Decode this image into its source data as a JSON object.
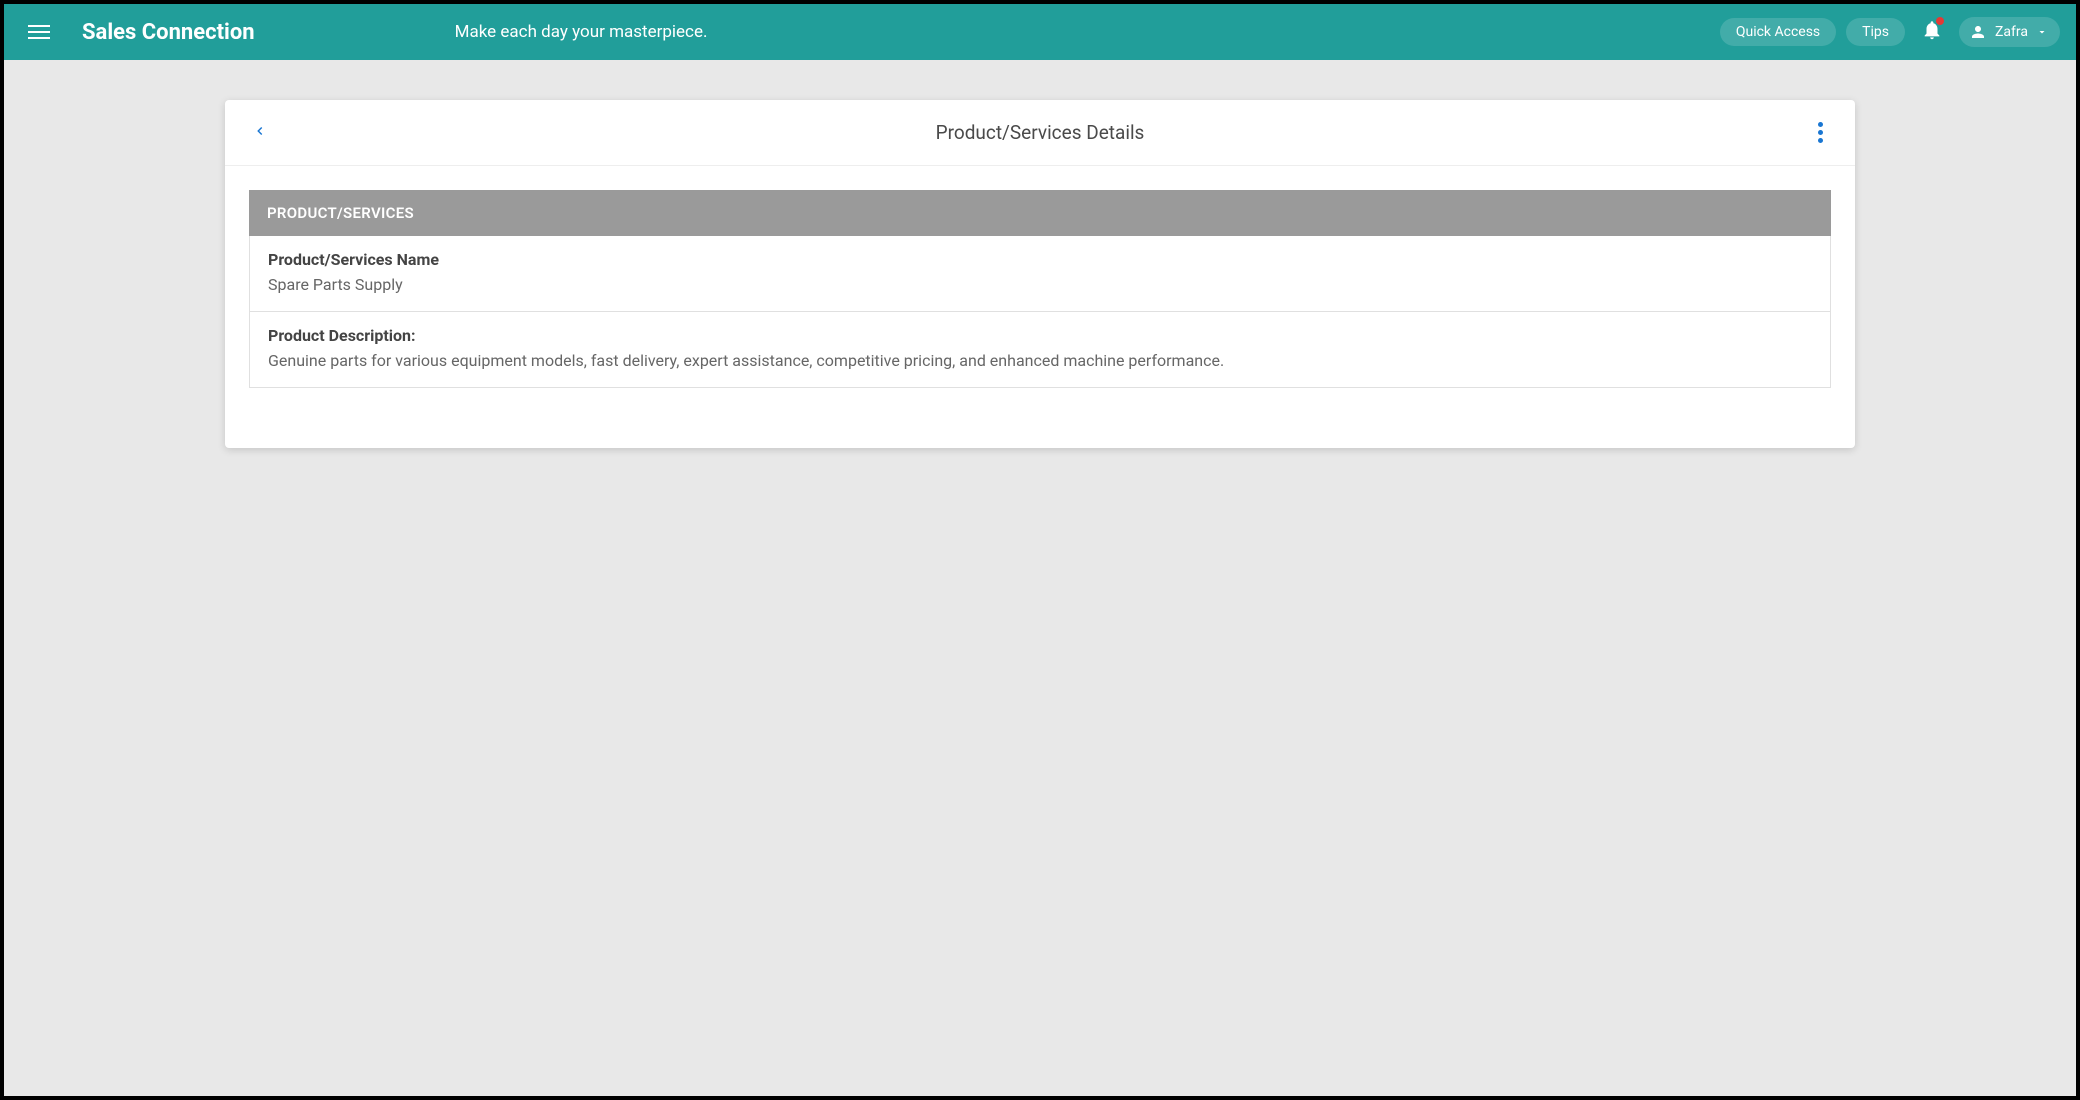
{
  "header": {
    "app_title": "Sales Connection",
    "tagline": "Make each day your masterpiece.",
    "quick_access_label": "Quick Access",
    "tips_label": "Tips",
    "user_name": "Zafra"
  },
  "card": {
    "title": "Product/Services Details",
    "section_header": "PRODUCT/SERVICES",
    "fields": [
      {
        "label": "Product/Services Name",
        "value": "Spare Parts Supply"
      },
      {
        "label": "Product Description:",
        "value": "Genuine parts for various equipment models, fast delivery, expert assistance, competitive pricing, and enhanced machine performance."
      }
    ]
  }
}
